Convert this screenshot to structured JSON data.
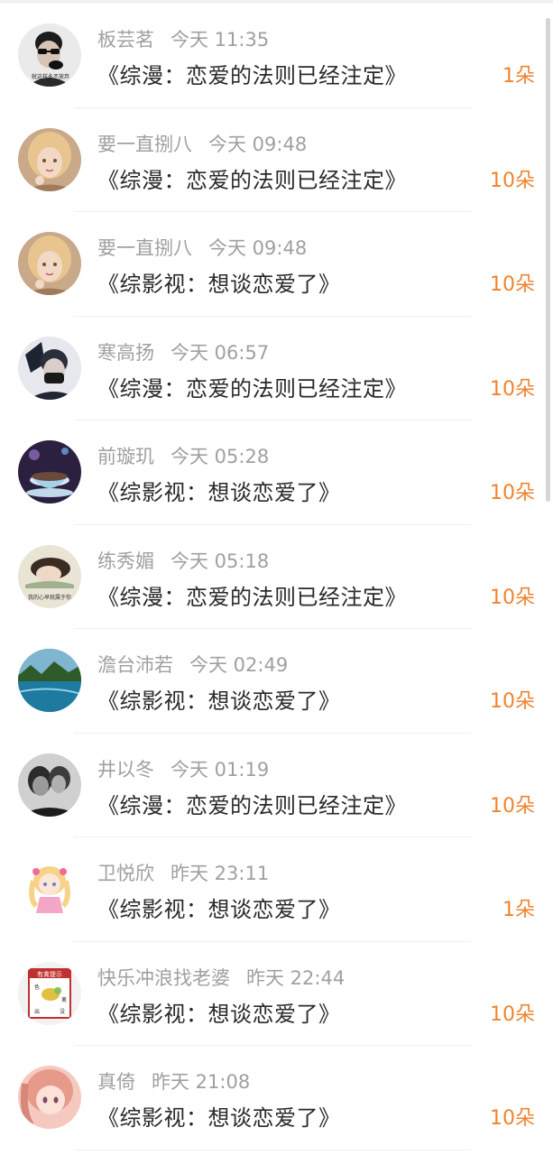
{
  "rows": [
    {
      "name": "板芸茗",
      "time": "今天 11:35",
      "book": "《综漫：恋爱的法则已经注定》",
      "count": "1朵",
      "avatar_icon": "avatar-man-sunglasses"
    },
    {
      "name": "要一直捌八",
      "time": "今天 09:48",
      "book": "《综漫：恋爱的法则已经注定》",
      "count": "10朵",
      "avatar_icon": "avatar-illustrated-girl"
    },
    {
      "name": "要一直捌八",
      "time": "今天 09:48",
      "book": "《综影视：想谈恋爱了》",
      "count": "10朵",
      "avatar_icon": "avatar-illustrated-girl"
    },
    {
      "name": "寒高扬",
      "time": "今天 06:57",
      "book": "《综漫：恋爱的法则已经注定》",
      "count": "10朵",
      "avatar_icon": "avatar-masked-man"
    },
    {
      "name": "前璇玑",
      "time": "今天 05:28",
      "book": "《综影视：想谈恋爱了》",
      "count": "10朵",
      "avatar_icon": "avatar-teacup"
    },
    {
      "name": "练秀媚",
      "time": "今天 05:18",
      "book": "《综漫：恋爱的法则已经注定》",
      "count": "10朵",
      "avatar_icon": "avatar-sleeping-girl"
    },
    {
      "name": "澹台沛若",
      "time": "今天 02:49",
      "book": "《综影视：想谈恋爱了》",
      "count": "10朵",
      "avatar_icon": "avatar-lake-landscape"
    },
    {
      "name": "井以冬",
      "time": "今天 01:19",
      "book": "《综漫：恋爱的法则已经注定》",
      "count": "10朵",
      "avatar_icon": "avatar-couple-bw"
    },
    {
      "name": "卫悦欣",
      "time": "昨天 23:11",
      "book": "《综影视：想谈恋爱了》",
      "count": "1朵",
      "avatar_icon": "avatar-anime-girl"
    },
    {
      "name": "快乐冲浪找老婆",
      "time": "昨天 22:44",
      "book": "《综影视：想谈恋爱了》",
      "count": "10朵",
      "avatar_icon": "avatar-bird-sign"
    },
    {
      "name": "真倚",
      "time": "昨天 21:08",
      "book": "《综影视：想谈恋爱了》",
      "count": "10朵",
      "avatar_icon": "avatar-pink-anime"
    }
  ],
  "avatar_texts": {
    "sunglasses": "就这样永不放弃",
    "sleeping": "我的心早就属于你",
    "sign_top": "有禽提示",
    "sign_l1": "色",
    "sign_r1": "禽",
    "sign_l2": "出",
    "sign_r2": "没"
  },
  "colors": {
    "name": "#a0a0a0",
    "book": "#2a2a2a",
    "count": "#f0832e"
  }
}
